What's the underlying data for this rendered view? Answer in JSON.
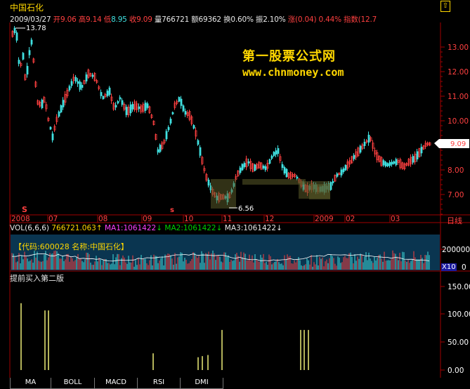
{
  "header": {
    "stock_name": "中国石化",
    "up_arrow": "⇧",
    "date": "2009/03/27",
    "open_label": "开",
    "open": "9.06",
    "high_label": "高",
    "high": "9.14",
    "low_label": "低",
    "low": "8.95",
    "close_label": "收",
    "close": "9.09",
    "volume_label": "量",
    "volume": "766721",
    "amount_label": "额",
    "amount": "69362",
    "turnover_label": "换",
    "turnover": "0.60%",
    "amplitude_label": "振",
    "amplitude": "2.10%",
    "change_label": "涨",
    "change": "(0.04)",
    "change_pct": "0.44%",
    "index_label": "指数",
    "index_value": "(12.7"
  },
  "watermark": {
    "line1": "第一股票公式网",
    "line2": "www.chnmoney.com"
  },
  "price_chart": {
    "price_axis": [
      "13.00",
      "12.00",
      "11.00",
      "10.00",
      "9.00",
      "8.00",
      "7.00"
    ],
    "current_price_tag": "9.09",
    "max_label": "13.78",
    "min_label": "6.56",
    "time_axis": [
      "2008",
      "07",
      "08",
      "09",
      "10",
      "11",
      "12",
      "2009",
      "02",
      "03"
    ],
    "period": "日线",
    "signals": [
      "S",
      "s"
    ]
  },
  "volume_panel": {
    "legend_name": "VOL(6,6,6)",
    "legend_value": "766721.063",
    "ma1": "MA1:1061422",
    "ma2": "MA2:1061422",
    "ma3": "MA3:1061422",
    "code_text": "【代码:600028 名称:中国石化】",
    "axis_top": "200000",
    "axis_bottom": "0",
    "unit": "X10"
  },
  "indicator_panel": {
    "title": "提前买入第二版",
    "axis": [
      "150.00",
      "100.00",
      "50.00",
      "0.00"
    ]
  },
  "tabs": [
    "MA",
    "BOLL",
    "MACD",
    "RSI",
    "DMI"
  ],
  "colors": {
    "up": "#ff4040",
    "down": "#40e0e0",
    "signal": "#ffff80",
    "grid": "#a00000"
  }
}
